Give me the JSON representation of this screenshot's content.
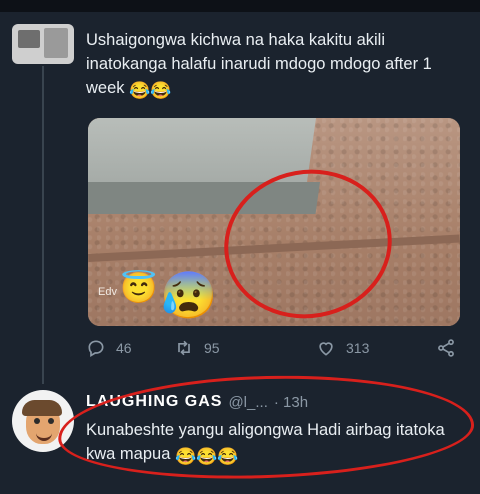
{
  "tweet": {
    "text": "Ushaigongwa kichwa na haka kakitu akili inatokanga halafu inarudi mdogo mdogo after 1 week",
    "emoji": "😂😂",
    "media_watermark": "Edv",
    "stats": {
      "replies": "46",
      "retweets": "95",
      "likes": "313"
    }
  },
  "reply": {
    "name": "LAUGHING GAS",
    "handle": "@l_...",
    "time": "· 13h",
    "text": "Kunabeshte yangu aligongwa Hadi airbag itatoka kwa mapua",
    "emoji": "😂😂😂"
  },
  "icons": {
    "reply": "reply-icon",
    "retweet": "retweet-icon",
    "like": "heart-icon",
    "share": "share-icon"
  },
  "colors": {
    "background": "#1b232e",
    "text": "#e9eef2",
    "muted": "#8b98a5",
    "annotation_red": "#d8201c"
  }
}
